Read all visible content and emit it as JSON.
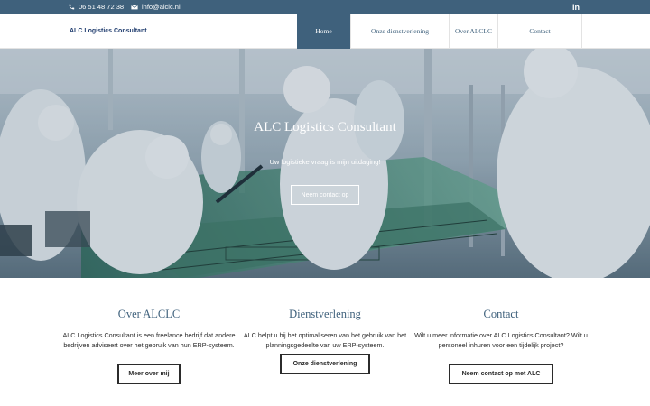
{
  "topbar": {
    "phone": "06 51 48 72 38",
    "email": "info@alclc.nl",
    "linkedin_icon": "linkedin-icon",
    "background": "#3f617c"
  },
  "header": {
    "logo_text": "ALC Logistics Consultant",
    "nav": [
      {
        "label": "Home",
        "active": true
      },
      {
        "label": "Onze dienstverlening",
        "active": false
      },
      {
        "label": "Over ALCLC",
        "active": false
      },
      {
        "label": "Contact",
        "active": false
      }
    ]
  },
  "hero": {
    "title": "ALC Logistics Consultant",
    "subtitle": "Uw logistieke vraag is mijn uitdaging!",
    "button": "Neem contact op"
  },
  "columns": [
    {
      "heading": "Over ALCLC",
      "text": "ALC Logistics Consultant is een freelance bedrijf dat andere bedrijven adviseert over het gebruik van hun ERP-systeem.",
      "button": "Meer over mij"
    },
    {
      "heading": "Dienstverlening",
      "text": "ALC helpt u bij het optimaliseren van het gebruik van het planningsgedeelte van uw ERP-systeem.",
      "button": "Onze dienstverlening"
    },
    {
      "heading": "Contact",
      "text": "Wilt u meer informatie over ALC Logistics Consultant? Wilt u personeel inhuren voor een tijdelijk project?",
      "button": "Neem contact op met ALC"
    }
  ],
  "colors": {
    "accent": "#3f617c",
    "logo": "#1f3c6e",
    "text": "#2b2b2b"
  }
}
